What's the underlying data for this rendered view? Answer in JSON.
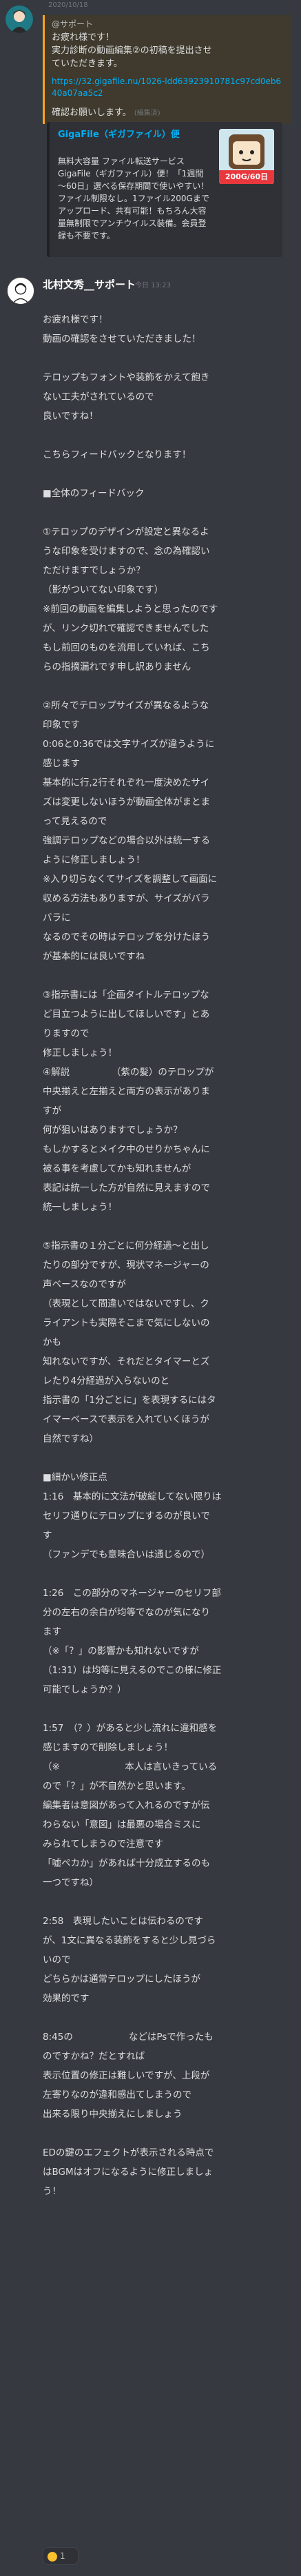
{
  "previous_message": {
    "date": "2020/10/18",
    "quote_lines": [
      "@サポート",
      "お疲れ様です！",
      "実力診断の動画編集②の初稿を提出させ",
      "ていただきます。"
    ],
    "link": "https://32.gigafile.nu/1026-ldd63923910781c97cd0eb640a07aa5c2",
    "confirm_text": "確認お願いします。",
    "edited": "(編集済)",
    "embed": {
      "title": "GigaFile（ギガファイル）便",
      "description": "無料大容量 ファイル転送サービス GigaFile（ギガファイル）便！「1週間～60日」選べる保存期間で使いやすい！ファイル制限なし。1ファイル200Gまでアップロード、共有可能！もちろん大容量無制限でアンチウイルス装備。会員登録も不要です。",
      "thumb_badge": "200G/60日"
    }
  },
  "message": {
    "author": "北村文秀__サポート",
    "timestamp": "今日 13:23",
    "lines": [
      "お疲れ様です！",
      "動画の確認をさせていただきました！",
      "",
      "テロップもフォントや装飾をかえて飽き",
      "ない工夫がされているので",
      "良いですね！",
      "",
      "こちらフィードバックとなります！",
      "",
      "■全体のフィードバック",
      "",
      "①テロップのデザインが設定と異なるよ",
      "うな印象を受けますので、念の為確認い",
      "ただけますでしょうか？",
      "（影がついてない印象です）",
      "※前回の動画を編集しようと思ったのです",
      "が、リンク切れで確認できませんでした",
      "もし前回のものを流用していれば、こち",
      "らの指摘漏れです申し訳ありません",
      "",
      "②所々でテロップサイズが異なるような",
      "印象です",
      "0:06と0:36では文字サイズが違うように",
      "感じます",
      "基本的に行,2行それぞれ一度決めたサイ",
      "ズは変更しないほうが動画全体がまとま",
      "って見えるので",
      "強調テロップなどの場合以外は統一する",
      "ように修正しましょう！",
      "※入り切らなくてサイズを調整して画面に",
      "収める方法もありますが、サイズがバラ",
      "バラに",
      "なるのでその時はテロップを分けたほう",
      "が基本的には良いですね",
      "",
      "③指示書には「企画タイトルテロップな",
      "ど目立つように出してほしいです」とあ",
      "りますので",
      "修正しましょう！",
      "④解説　　　　　（紫の髪）のテロップが",
      "中央揃えと左揃えと両方の表示がありま",
      "すが",
      "何が狙いはありますでしょうか？",
      "もしかするとメイク中のせりかちゃんに",
      "被る事を考慮してかも知れませんが",
      "表記は統一した方が自然に見えますので",
      "統一しましょう！",
      "",
      "⑤指示書の１分ごとに何分経過～と出し",
      "たりの部分ですが、現状マネージャーの",
      "声ベースなのですが",
      "（表現として間違いではないですし、ク",
      "ライアントも実際そこまで気にしないの",
      "かも",
      "知れないですが、それだとタイマーとズ",
      "レたり4分経過が入らないのと",
      "指示書の「1分ごとに」を表現するにはタ",
      "イマーベースで表示を入れていくほうが",
      "自然ですね）",
      "",
      "■細かい修正点",
      "1:16　基本的に文法が破綻してない限りは",
      "セリフ通りにテロップにするのが良いで",
      "す",
      "（ファンデでも意味合いは通じるので）",
      "",
      "1:26　この部分のマネージャーのセリフ部",
      "分の左右の余白が均等でなのが気になり",
      "ます",
      "（※「？」の影響かも知れないですが",
      "（1:31）は均等に見えるのでこの様に修正",
      "可能でしょうか？）",
      "",
      "1:57　（？）があると少し流れに違和感を",
      "感じますので削除しましょう！",
      "（※　　　　　　　本人は言いきっている",
      "ので「？」が不自然かと思います。",
      "編集者は意図があって入れるのですが伝",
      "わらない「意図」は最悪の場合ミスに",
      "みられてしまうので注意です",
      "「嘘ペカか」があれば十分成立するのも",
      "一つですね）",
      "",
      "2:58　表現したいことは伝わるのです",
      "が、1文に異なる装飾をすると少し見づら",
      "いので",
      "どちらかは通常テロップにしたほうが",
      "効果的です",
      "",
      "8:45の　　　　　　などはPsで作ったも",
      "のですかね？だとすれば",
      "表示位置の修正は難しいですが、上段が",
      "左寄りなのが違和感出てしまうので",
      "出来る限り中央揃えにしましょう",
      "",
      "EDの鍵のエフェクトが表示される時点で",
      "はBGMはオフになるように修正しましょ",
      "う！"
    ],
    "reaction": {
      "emoji": "thumbs-up-icon",
      "count": "1"
    }
  },
  "colors": {
    "background": "#36393f",
    "quote_bar": "#faa61a",
    "link": "#00aff4"
  }
}
